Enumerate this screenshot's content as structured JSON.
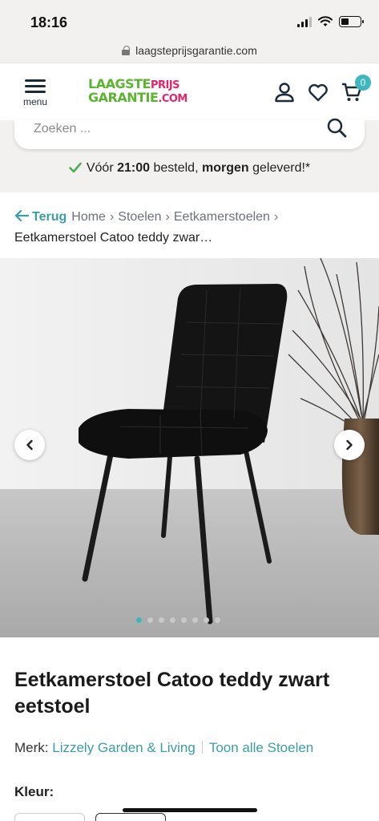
{
  "status_bar": {
    "time": "18:16"
  },
  "browser": {
    "url": "laagsteprijsgarantie.com"
  },
  "header": {
    "menu_label": "menu",
    "logo_line1_a": "LAAGSTE",
    "logo_line1_b": "PRIJS",
    "logo_line2_a": "GARANTIE",
    "logo_line2_b": ".COM",
    "cart_count": "0",
    "icons": [
      "user-icon",
      "heart-icon",
      "cart-icon"
    ]
  },
  "search": {
    "placeholder": "Zoeken ..."
  },
  "delivery": {
    "prefix": "Vóór ",
    "time": "21:00",
    "middle": " besteld, ",
    "day": "morgen",
    "suffix": " geleverd!*"
  },
  "breadcrumb": {
    "back_label": "Terug",
    "items": [
      "Home",
      "Stoelen",
      "Eetkamerstoelen"
    ],
    "current": "Eetkamerstoel Catoo teddy zwar…"
  },
  "gallery": {
    "slide_count": 8,
    "active_index": 0
  },
  "product": {
    "title": "Eetkamerstoel Catoo teddy zwart eetstoel",
    "brand_label": "Merk:",
    "brand": "Lizzely Garden & Living",
    "show_all_link": "Toon alle Stoelen",
    "color_label": "Kleur:"
  },
  "colors": {
    "accent": "#3db8c0",
    "logo_green": "#5bb531",
    "logo_pink": "#e6246c",
    "check_green": "#4caf50"
  }
}
